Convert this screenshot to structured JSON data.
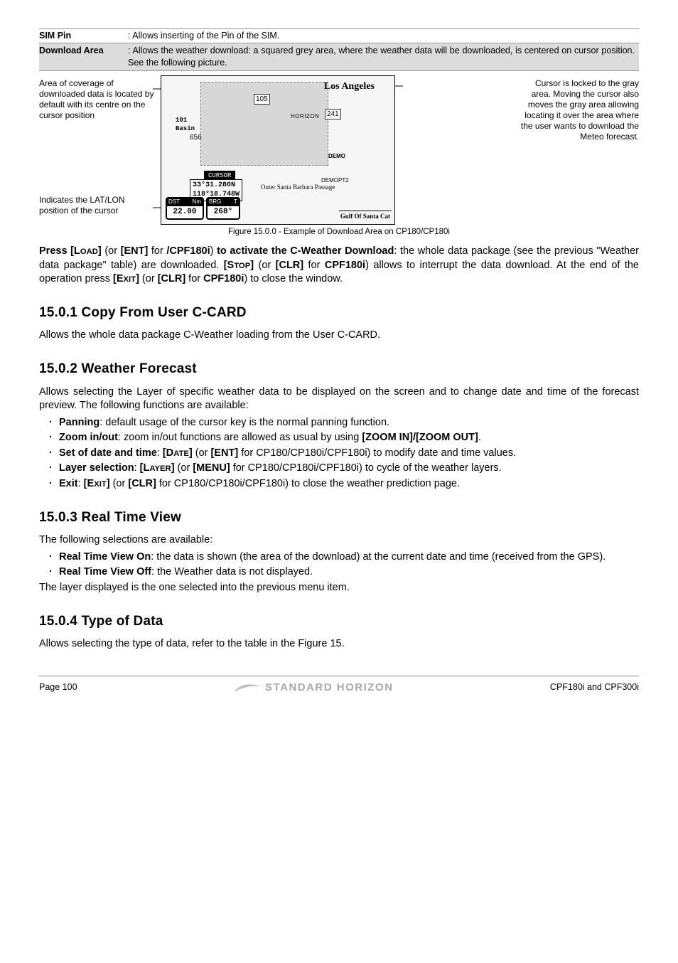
{
  "defs": {
    "simpin": {
      "term": "SIM Pin",
      "desc": "Allows inserting of the Pin of the SIM."
    },
    "dlarea": {
      "term": "Download Area",
      "desc": "Allows the weather download: a squared grey area, where the weather data will be downloaded, is centered on cursor position. See the following picture."
    }
  },
  "fig": {
    "left_top": "Area of coverage of downloaded data is located by default with its centre on the cursor position",
    "left_bottom": "Indicates the LAT/LON position of the cursor",
    "right": "Cursor is locked to the gray area. Moving the cursor also moves the gray area allowing locating it over the area where the user wants to download the Meteo forecast.",
    "map": {
      "city": "Los Angeles",
      "basin": "101\nBasin",
      "cursor_lbl": "CURSOR",
      "lat": "33°31.280N",
      "lon": "118°18.748W",
      "passage": "Outer Santa Barbara Passage",
      "bar_dst": "DST",
      "bar_nm": "Nm",
      "bar_brg": "BRG",
      "bar_t": "T",
      "bar_val1": "22.00",
      "bar_val2": "268°",
      "gulf": "Gulf Of Santa Cat",
      "n105": "105",
      "n241": "241",
      "n656": "656",
      "demo": "DEMO",
      "horizon": "HORIZON",
      "demopt": "DEMOPT2"
    },
    "caption": "Figure 15.0.0 - Example of Download Area on CP180/CP180i"
  },
  "p_main": {
    "t1a": "Press [L",
    "t1b": "OAD",
    "t1c": "]",
    "t2": " (or ",
    "t3": "[ENT]",
    "t4": " for ",
    "t5": "/CPF180i",
    "t6": ") ",
    "t7": "to activate the C-Weather Download",
    "t8": ": the whole data package (see the previous \"Weather data package\" table) are downloaded. ",
    "t9a": "[S",
    "t9b": "TOP",
    "t9c": "]",
    "t10": " (or ",
    "t11": "[CLR]",
    "t12": "  for ",
    "t13": "CPF180i",
    "t14": ") allows to interrupt the data download. At the end of the operation press ",
    "t15a": "[E",
    "t15b": "XIT",
    "t15c": "]",
    "t16": " (or ",
    "t17": "[CLR]",
    "t18": "  for ",
    "t19": "CPF180i",
    "t20": ") to close the window."
  },
  "s1": {
    "h": "15.0.1  Copy From User C-CARD",
    "p": "Allows the whole data package C-Weather loading from the User C-CARD."
  },
  "s2": {
    "h": "15.0.2  Weather Forecast",
    "p": "Allows selecting the Layer of specific weather data to be displayed on the screen and to change date and time of the forecast preview. The following functions are available:",
    "li1a": "Panning",
    "li1b": ": default usage of the cursor key is the normal panning function.",
    "li2a": "Zoom in/out",
    "li2b": ": zoom in/out functions are allowed as usual by using ",
    "li2c": "[ZOOM IN]/[ZOOM OUT]",
    "li2d": ".",
    "li3a": "Set of date and time",
    "li3b": ": ",
    "li3c_a": "[D",
    "li3c_b": "ATE",
    "li3c_c": "]",
    "li3d": " (or ",
    "li3e": "[ENT]",
    "li3f": " for CP180/CP180i/CPF180i) to modify date and time values.",
    "li4a": "Layer selection",
    "li4b": ": ",
    "li4c_a": "[L",
    "li4c_b": "AYER",
    "li4c_c": "]",
    "li4d": " (or ",
    "li4e": "[MENU]",
    "li4f": " for CP180/CP180i/CPF180i) to cycle of the weather layers.",
    "li5a": "Exit",
    "li5b": ": ",
    "li5c_a": "[E",
    "li5c_b": "XIT",
    "li5c_c": "]",
    "li5d": " (or ",
    "li5e": "[CLR]",
    "li5f": " for CP180/CP180i/CPF180i) to close the weather prediction page."
  },
  "s3": {
    "h": "15.0.3  Real Time View",
    "p": "The following selections are available:",
    "li1a": "Real Time View On",
    "li1b": ": the data is shown (the area of the download) at the current date and time (received from the GPS).",
    "li2a": "Real Time View Off",
    "li2b": ": the Weather data is not displayed.",
    "p2": "The layer displayed is the one selected into the previous menu item."
  },
  "s4": {
    "h": "15.0.4  Type of Data",
    "p": "Allows selecting the type of data, refer to the table in the Figure 15."
  },
  "footer": {
    "page": "Page 100",
    "brand": "STANDARD HORIZON",
    "model": "CPF180i and CPF300i"
  }
}
